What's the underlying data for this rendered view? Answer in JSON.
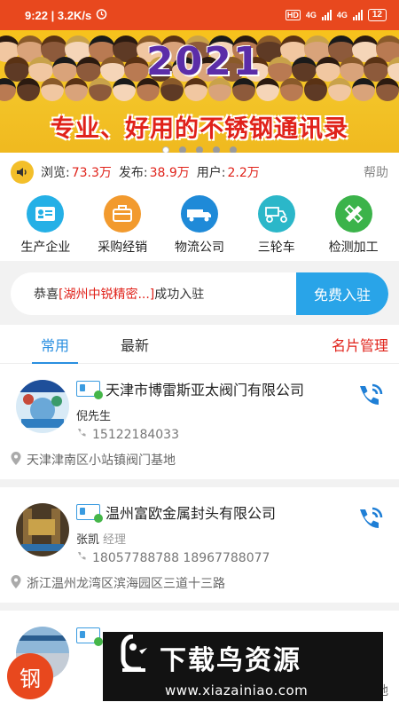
{
  "statusbar": {
    "time_speed": "9:22 | 3.2K/s",
    "battery": "12",
    "net1": "4G",
    "net2": "4G",
    "hd": "HD"
  },
  "banner": {
    "year": "2021",
    "slogan": "专业、好用的不锈钢通讯录",
    "dots": 5,
    "active_dot": 0
  },
  "stats": {
    "browse_label": "浏览:",
    "browse_value": "73.3万",
    "publish_label": "发布:",
    "publish_value": "38.9万",
    "users_label": "用户:",
    "users_value": "2.2万",
    "help": "帮助"
  },
  "categories": [
    {
      "label": "生产企业",
      "icon": "factory-contact-icon",
      "color": "#25b0e6"
    },
    {
      "label": "采购经销",
      "icon": "briefcase-icon",
      "color": "#f29a2e"
    },
    {
      "label": "物流公司",
      "icon": "truck-icon",
      "color": "#1f8ad8"
    },
    {
      "label": "三轮车",
      "icon": "tricycle-icon",
      "color": "#2bb7c9"
    },
    {
      "label": "检测加工",
      "icon": "ruler-pencil-icon",
      "color": "#3bb34a"
    }
  ],
  "notice": {
    "prefix": "恭喜",
    "highlight": "[湖州中锐精密...]",
    "suffix": "成功入驻",
    "button": "免费入驻"
  },
  "tabs": {
    "common": "常用",
    "latest": "最新",
    "manage": "名片管理"
  },
  "listings": [
    {
      "company": "天津市博雷斯亚太阀门有限公司",
      "person": "倪先生",
      "title": "",
      "phone": "15122184033",
      "address": "天津津南区小站镇阀门基地"
    },
    {
      "company": "温州富欧金属封头有限公司",
      "person": "张凯",
      "title": "经理",
      "phone": "18057788788 18967788077",
      "address": "浙江温州龙湾区滨海园区三道十三路"
    }
  ],
  "float_button": "钢",
  "watermark": {
    "title": "下载鸟资源",
    "url": "www.xiazainiao.com"
  },
  "tail_text": "地"
}
